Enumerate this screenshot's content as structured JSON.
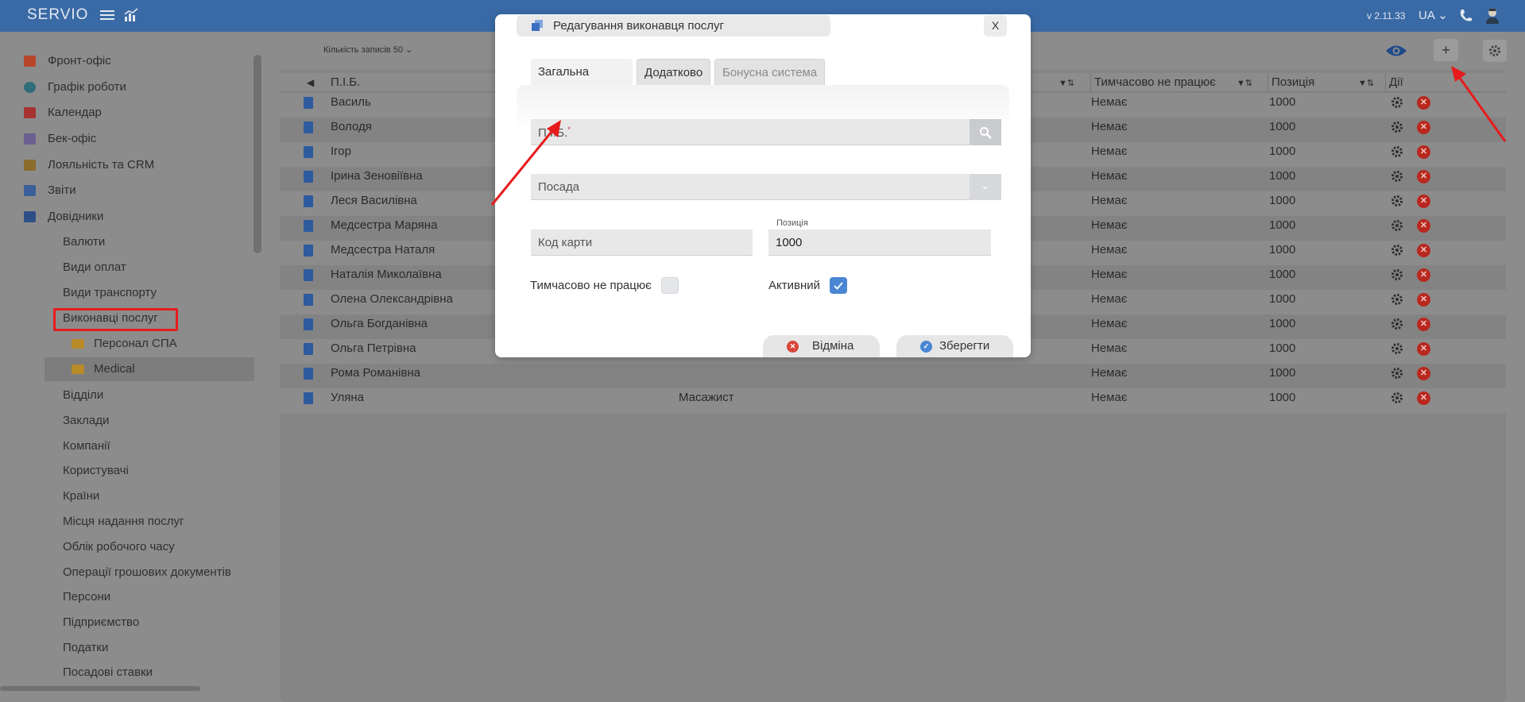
{
  "topbar": {
    "logo": "SERVIO",
    "version": "v 2.11.33",
    "language": "UA"
  },
  "sidebar": {
    "items": [
      {
        "label": "Фронт-офіс",
        "icon": "briefcase-icon",
        "color": "#c0392b"
      },
      {
        "label": "Графік роботи",
        "icon": "clock-icon",
        "color": "#2f6d7a"
      },
      {
        "label": "Календар",
        "icon": "calendar-icon",
        "color": "#a33"
      },
      {
        "label": "Бек-офіс",
        "icon": "list-icon",
        "color": "#6b5f8f"
      },
      {
        "label": "Лояльність та CRM",
        "icon": "people-icon",
        "color": "#8a6d2a"
      },
      {
        "label": "Звіти",
        "icon": "report-icon",
        "color": "#3a5f9a"
      },
      {
        "label": "Довідники",
        "icon": "book-icon",
        "color": "#2d4f86"
      }
    ],
    "subitems": [
      "Валюти",
      "Види оплат",
      "Види транспорту",
      "Виконавці послуг",
      "Відділи",
      "Заклади",
      "Компанії",
      "Користувачі",
      "Країни",
      "Місця надання послуг",
      "Облік робочого часу",
      "Операції грошових документів",
      "Персони",
      "Підприємство",
      "Податки",
      "Посадові ставки"
    ],
    "folders": [
      "Персонал СПА",
      "Medical"
    ]
  },
  "toolbar": {
    "records_label": "Кількість записів",
    "records_value": "50",
    "add_button": "+"
  },
  "table": {
    "columns": [
      "П.І.Б.",
      "Тимчасово не працює",
      "Позиція",
      "Дії"
    ],
    "rows": [
      {
        "name": "Василь",
        "position": "",
        "temp": "Немає",
        "pos": "1000"
      },
      {
        "name": "Володя",
        "position": "",
        "temp": "Немає",
        "pos": "1000"
      },
      {
        "name": "Ігор",
        "position": "",
        "temp": "Немає",
        "pos": "1000"
      },
      {
        "name": "Ірина Зеновіївна",
        "position": "",
        "temp": "Немає",
        "pos": "1000"
      },
      {
        "name": "Леся Василівна",
        "position": "",
        "temp": "Немає",
        "pos": "1000"
      },
      {
        "name": "Медсестра Маряна",
        "position": "",
        "temp": "Немає",
        "pos": "1000"
      },
      {
        "name": "Медсестра Наталя",
        "position": "",
        "temp": "Немає",
        "pos": "1000"
      },
      {
        "name": "Наталія Миколаївна",
        "position": "",
        "temp": "Немає",
        "pos": "1000"
      },
      {
        "name": "Олена Олександрівна",
        "position": "",
        "temp": "Немає",
        "pos": "1000"
      },
      {
        "name": "Ольга Богданівна",
        "position": "",
        "temp": "Немає",
        "pos": "1000"
      },
      {
        "name": "Ольга Петрівна",
        "position": "",
        "temp": "Немає",
        "pos": "1000"
      },
      {
        "name": "Рома Романівна",
        "position": "",
        "temp": "Немає",
        "pos": "1000"
      },
      {
        "name": "Уляна",
        "position": "Масажист",
        "temp": "Немає",
        "pos": "1000"
      }
    ]
  },
  "modal": {
    "title": "Редагування виконавця послуг",
    "close": "X",
    "tabs": [
      "Загальна",
      "Додатково",
      "Бонусна система"
    ],
    "fio_placeholder": "П.І.Б.",
    "required_mark": "*",
    "position_placeholder": "Посада",
    "card_placeholder": "Код карти",
    "position_label": "Позиція",
    "position_value": "1000",
    "temp_label": "Тимчасово не працює",
    "temp_checked": false,
    "active_label": "Активний",
    "active_checked": true,
    "cancel": "Відміна",
    "save": "Зберегти"
  },
  "colors": {
    "topbar": "#3a6aa6",
    "highlight": "#e61c1c",
    "checkbox_active": "#4a86d4",
    "delete": "#b8281e"
  }
}
